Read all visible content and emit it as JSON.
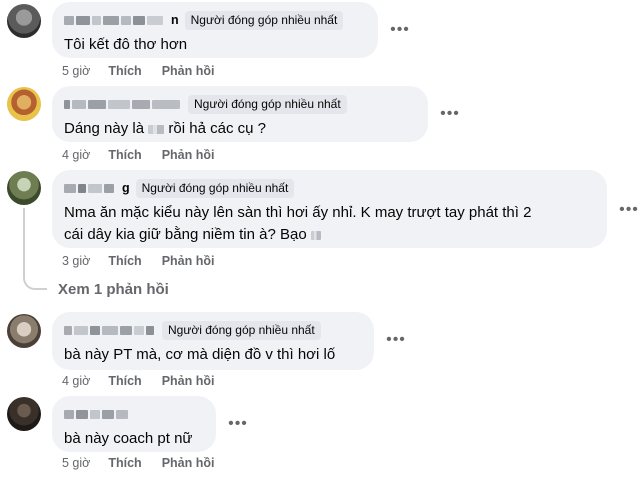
{
  "comments": [
    {
      "name_suffix": "n",
      "badge": "Người đóng góp nhiều nhất",
      "text": "Tôi kết đô thơ hơn",
      "time": "5 giờ",
      "like": "Thích",
      "reply": "Phản hồi"
    },
    {
      "name_suffix": "",
      "badge": "Người đóng góp nhiều nhất",
      "text_before": "Dáng này là",
      "text_after": "rồi hả các cụ ?",
      "time": "4 giờ",
      "like": "Thích",
      "reply": "Phản hồi"
    },
    {
      "name_suffix": "g",
      "badge": "Người đóng góp nhiều nhất",
      "text_line1": "Nma ăn mặc kiểu này lên sàn thì hơi ấy nhỉ. K may trượt tay phát thì 2",
      "text_line2": "cái dây kia giữ bằng niềm tin à? Bạo",
      "time": "3 giờ",
      "like": "Thích",
      "reply": "Phản hồi",
      "view_replies": "Xem 1 phản hồi"
    },
    {
      "name_suffix": "",
      "badge": "Người đóng góp nhiều nhất",
      "text": "bà này PT mà, cơ mà diện đồ v thì hơi lố",
      "time": "4 giờ",
      "like": "Thích",
      "reply": "Phản hồi"
    },
    {
      "name_suffix": "",
      "text": "bà này coach pt nữ",
      "time": "5 giờ",
      "like": "Thích",
      "reply": "Phản hồi"
    }
  ],
  "icons": {
    "more": "more-options-icon"
  },
  "colors": {
    "bubble": "#f0f2f5",
    "badge": "#e4e6eb",
    "meta": "#65676b"
  }
}
